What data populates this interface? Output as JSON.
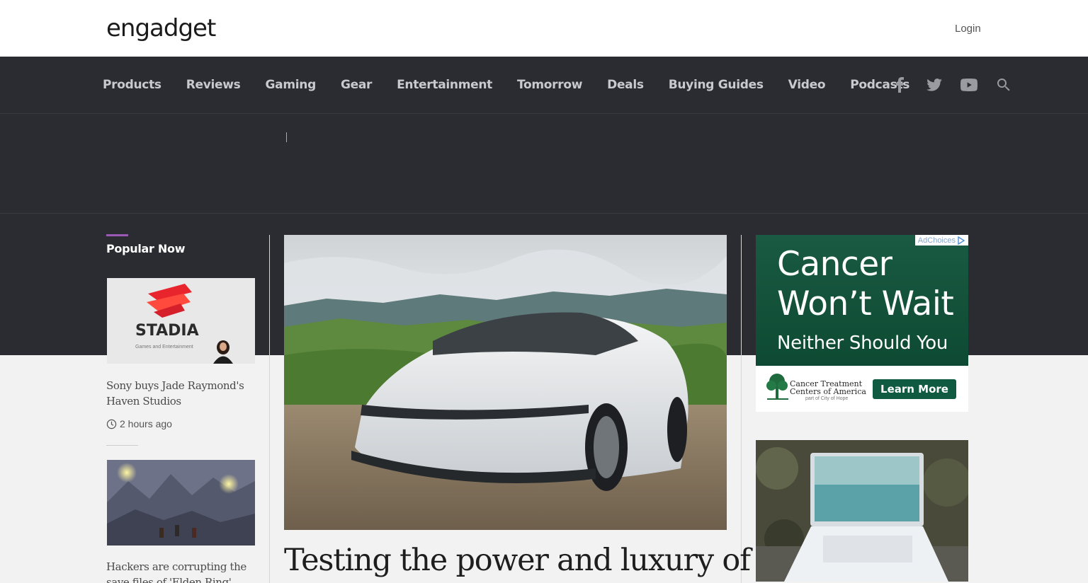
{
  "header": {
    "logo": "engadget",
    "login_label": "Login"
  },
  "nav": {
    "items": [
      {
        "label": "Products"
      },
      {
        "label": "Reviews"
      },
      {
        "label": "Gaming"
      },
      {
        "label": "Gear"
      },
      {
        "label": "Entertainment"
      },
      {
        "label": "Tomorrow"
      },
      {
        "label": "Deals"
      },
      {
        "label": "Buying Guides"
      },
      {
        "label": "Video"
      },
      {
        "label": "Podcasts"
      }
    ],
    "social_icons": [
      "facebook-icon",
      "twitter-icon",
      "youtube-icon",
      "search-icon"
    ]
  },
  "popular": {
    "title": "Popular Now",
    "stories": [
      {
        "thumb_text": "STADIA",
        "thumb_subtext": "Games and Entertainment",
        "title": "Sony buys Jade Raymond's Haven Studios",
        "time": "2 hours ago"
      },
      {
        "title": "Hackers are corrupting the save files of 'Elden Ring'"
      }
    ]
  },
  "main": {
    "headline": "Testing the power and luxury of"
  },
  "ad": {
    "adchoices": "AdChoices",
    "headline_line1": "Cancer",
    "headline_line2": "Won’t Wait",
    "subline": "Neither Should You",
    "org_line1": "Cancer Treatment",
    "org_line2": "Centers of America",
    "org_sub": "part of City of Hope",
    "cta": "Learn More"
  },
  "colors": {
    "nav_bg": "#2b2c31",
    "accent": "#9b59b6",
    "ad_green": "#0f4d35"
  }
}
